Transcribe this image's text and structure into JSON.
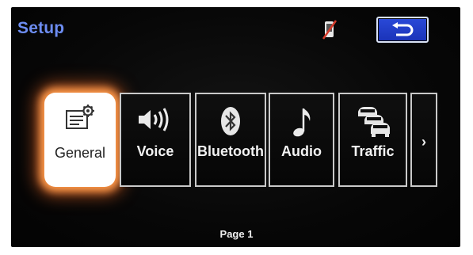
{
  "header": {
    "title": "Setup"
  },
  "icons": {
    "phone": "phone-disabled-icon",
    "back": "back-arrow-icon"
  },
  "tiles": [
    {
      "label": "General",
      "icon": "settings-document-icon",
      "selected": true
    },
    {
      "label": "Voice",
      "icon": "speaker-icon",
      "selected": false
    },
    {
      "label": "Bluetooth",
      "icon": "bluetooth-icon",
      "selected": false
    },
    {
      "label": "Audio",
      "icon": "music-note-icon",
      "selected": false
    },
    {
      "label": "Traffic",
      "icon": "traffic-cars-icon",
      "selected": false
    }
  ],
  "more": {
    "symbol": "›"
  },
  "footer": {
    "page_label": "Page 1"
  },
  "colors": {
    "title": "#6d8df2",
    "back_button": "#2140cc",
    "selected_glow": "#ff9a4a"
  }
}
